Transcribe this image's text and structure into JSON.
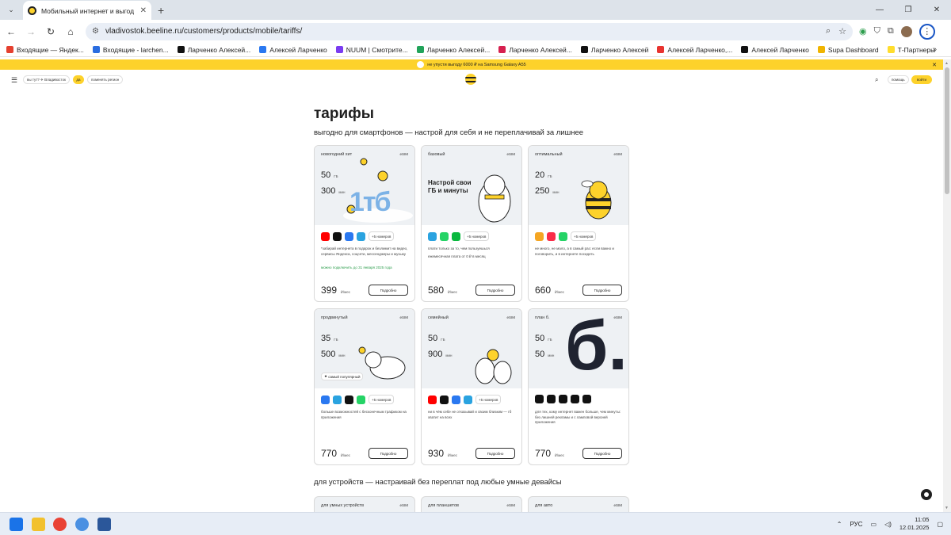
{
  "browser": {
    "tab_title": "Мобильный интернет и выгод",
    "url": "vladivostok.beeline.ru/customers/products/mobile/tariffs/"
  },
  "bookmarks": [
    {
      "label": "Входящие — Яндек...",
      "color": "#e5402f"
    },
    {
      "label": "Входящие - larchen...",
      "color": "#2a6de0"
    },
    {
      "label": "Ларченко Алексей...",
      "color": "#111111"
    },
    {
      "label": "Алексей Ларченко",
      "color": "#2a78f0"
    },
    {
      "label": "NUUM | Смотрите...",
      "color": "#7a3cf0"
    },
    {
      "label": "Ларченко Алексей...",
      "color": "#21a35a"
    },
    {
      "label": "Ларченко Алексей...",
      "color": "#d6204f"
    },
    {
      "label": "Ларченко Алексей",
      "color": "#111111"
    },
    {
      "label": "Алексей Ларченко,...",
      "color": "#e8332f"
    },
    {
      "label": "Алексей Ларченко",
      "color": "#111111"
    },
    {
      "label": "Supa Dashboard",
      "color": "#f0b400"
    },
    {
      "label": "Т-Партнеры",
      "color": "#ffdd2d"
    }
  ],
  "promo": {
    "text": "не упусти выгоду 6000 ₽ на Samsung Galaxy A55"
  },
  "site_header": {
    "city_question": "вы тут? ✈ Владивосток",
    "yes": "да",
    "change_region": "поменять регион",
    "help": "помощь",
    "login": "войти"
  },
  "page": {
    "title": "тарифы",
    "subtitle_smartphones": "выгодно для смартфонов — настрой для себя и не переплачивай за лишнее",
    "subtitle_devices": "для устройств — настраивай без переплат под любые умные девайсы"
  },
  "cards": [
    {
      "name": "новогодний хит",
      "esim": "eSIM",
      "gb": "50",
      "gb_unit": "ГБ",
      "min": "300",
      "min_unit": "мин",
      "art": "1тб",
      "plus": "+5 номеров",
      "desc": "*забирай интернета в подарок и безлимит на видео, сервисы Яндекса, соцсети, мессенджеры и музыку",
      "note": "можно подключить до 31 января 2025 года",
      "price": "399",
      "price_unit": "₽/мес",
      "more": "Подробно",
      "apps": [
        "#ff0000",
        "#111111",
        "#2a78f0",
        "#2aa3e0"
      ]
    },
    {
      "name": "базовый",
      "esim": "eSIM",
      "art": "Настрой свои ГБ и минуты",
      "plus": "+5 номеров",
      "desc": "плати только за то, чем пользуешься",
      "note2": "ежемесячная плата от 0 ₽ в месяц",
      "price": "580",
      "price_unit": "₽/мес",
      "more": "Подробно",
      "apps": [
        "#2aa3e0",
        "#25d366",
        "#09b83e"
      ]
    },
    {
      "name": "оптимальный",
      "esim": "eSIM",
      "gb": "20",
      "gb_unit": "ГБ",
      "min": "250",
      "min_unit": "мин",
      "plus": "+5 номеров",
      "desc": "не много, не мало, а в самый раз: если важно и поговорить, и в интернете посидеть",
      "price": "660",
      "price_unit": "₽/мес",
      "more": "Подробно",
      "apps": [
        "#f5a623",
        "#fa2d48",
        "#25d366"
      ]
    },
    {
      "name": "продвинутый",
      "esim": "eSIM",
      "gb": "35",
      "gb_unit": "ГБ",
      "min": "500",
      "min_unit": "мин",
      "badge": "самый популярный",
      "plus": "+5 номеров",
      "desc": "больше возможностей с бесконечным трафиком на приложения",
      "price": "770",
      "price_unit": "₽/мес",
      "more": "Подробно",
      "apps": [
        "#2a78f0",
        "#2aa3e0",
        "#111111",
        "#25d366"
      ]
    },
    {
      "name": "семейный",
      "esim": "eSIM",
      "gb": "50",
      "gb_unit": "ГБ",
      "min": "900",
      "min_unit": "мин",
      "plus": "+5 номеров",
      "desc": "ни в чём себе не отказывай и своим близким — гб хватит на всех",
      "price": "930",
      "price_unit": "₽/мес",
      "more": "Подробно",
      "apps": [
        "#ff0000",
        "#111111",
        "#2a78f0",
        "#2aa3e0"
      ]
    },
    {
      "name": "план б.",
      "esim": "eSIM",
      "gb": "50",
      "gb_unit": "ГБ",
      "min": "50",
      "min_unit": "мин",
      "art": "б.",
      "desc": "для тех, кому интернет важен больше, чем минуты: без лишней рекламы и с ламповой версией приложения",
      "price": "770",
      "price_unit": "₽/мес",
      "more": "Подробно",
      "apps": [
        "#111111",
        "#111111",
        "#111111",
        "#111111",
        "#111111"
      ]
    }
  ],
  "device_cards": [
    {
      "name": "для умных устройств",
      "esim": "eSIM"
    },
    {
      "name": "для планшетов",
      "esim": "eSIM"
    },
    {
      "name": "для авто",
      "esim": "eSIM"
    }
  ],
  "taskbar": {
    "lang": "РУС",
    "time": "11:05",
    "date": "12.01.2025"
  }
}
